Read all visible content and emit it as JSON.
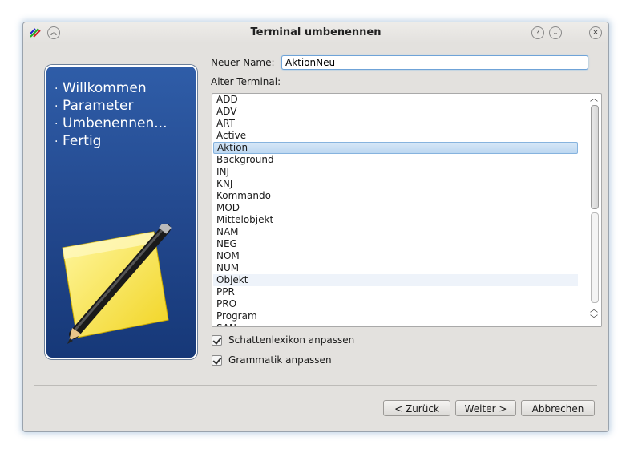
{
  "window": {
    "title": "Terminal umbenennen"
  },
  "sidebar": {
    "steps": [
      "Willkommen",
      "Parameter",
      "Umbenennen...",
      "Fertig"
    ]
  },
  "form": {
    "new_name_label": "Neuer Name:",
    "new_name_value": "AktionNeu",
    "old_terminal_label": "Alter Terminal:",
    "terminals": [
      "ADD",
      "ADV",
      "ART",
      "Active",
      "Aktion",
      "Background",
      "INJ",
      "KNJ",
      "Kommando",
      "MOD",
      "Mittelobjekt",
      "NAM",
      "NEG",
      "NOM",
      "NUM",
      "Objekt",
      "PPR",
      "PRO",
      "Program",
      "SAN"
    ],
    "selected_terminal": "Aktion",
    "hovered_terminal": "Objekt",
    "checkbox_shadow_lexicon": "Schattenlexikon anpassen",
    "checkbox_grammar": "Grammatik anpassen"
  },
  "buttons": {
    "back": "< Zurück",
    "next": "Weiter >",
    "cancel": "Abbrechen"
  },
  "colors": {
    "sidebar_blue": "#2f5da8",
    "selection": "#bcd7f1",
    "focus_border": "#6fa3d8"
  }
}
